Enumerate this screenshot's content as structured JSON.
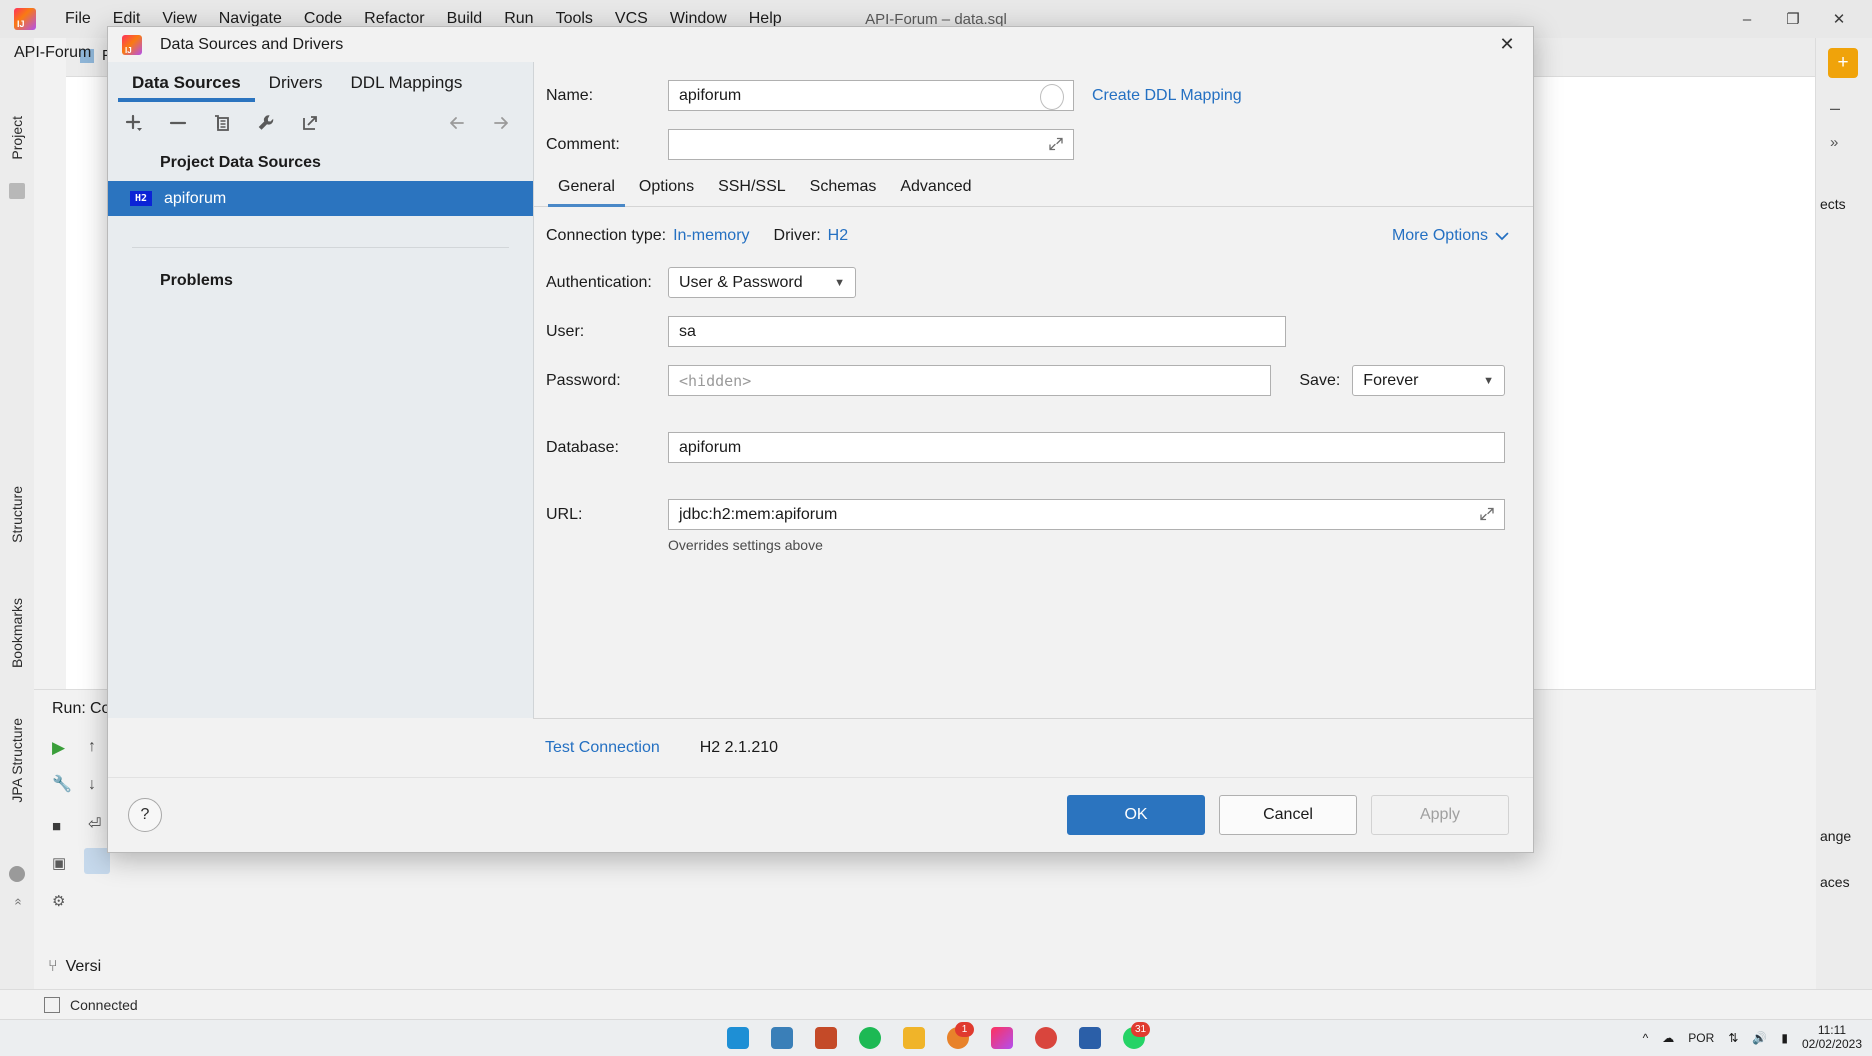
{
  "ide": {
    "window_title": "API-Forum – data.sql",
    "menu": [
      "File",
      "Edit",
      "View",
      "Navigate",
      "Code",
      "Refactor",
      "Build",
      "Run",
      "Tools",
      "VCS",
      "Window",
      "Help"
    ],
    "project_label": "API-Forum",
    "project_tab": "Proje",
    "left_rails": [
      "Project",
      "Structure",
      "Bookmarks",
      "JPA Structure"
    ],
    "run_label": "Run:",
    "run_tab": "Co",
    "version_control": "Versi",
    "status": "Connected",
    "right_edge_labels": [
      "ects",
      "ange",
      "aces"
    ],
    "window_buttons": [
      "–",
      "❐",
      "✕"
    ]
  },
  "taskbar": {
    "clock_time": "11:11",
    "clock_date": "02/02/2023",
    "language": "POR",
    "badges": [
      "1",
      "31"
    ]
  },
  "dialog": {
    "title": "Data Sources and Drivers",
    "close_label": "✕",
    "top_tabs": [
      {
        "label": "Data Sources",
        "active": true
      },
      {
        "label": "Drivers",
        "active": false
      },
      {
        "label": "DDL Mappings",
        "active": false
      }
    ],
    "toolbar": [
      {
        "name": "add-icon",
        "glyph": "+"
      },
      {
        "name": "remove-icon",
        "glyph": "–"
      },
      {
        "name": "copy-icon",
        "glyph": "❐"
      },
      {
        "name": "wrench-icon",
        "glyph": "🔧"
      },
      {
        "name": "open-external-icon",
        "glyph": "↗"
      },
      {
        "name": "back-arrow-icon",
        "glyph": "←"
      },
      {
        "name": "forward-arrow-icon",
        "glyph": "→"
      }
    ],
    "group_title": "Project Data Sources",
    "data_sources": [
      {
        "badge": "H2",
        "name": "apiforum",
        "selected": true
      }
    ],
    "problems_title": "Problems",
    "name_label": "Name:",
    "name_value": "apiforum",
    "comment_label": "Comment:",
    "comment_value": "",
    "create_ddl_mapping": "Create DDL Mapping",
    "inner_tabs": [
      {
        "label": "General",
        "active": true
      },
      {
        "label": "Options",
        "active": false
      },
      {
        "label": "SSH/SSL",
        "active": false
      },
      {
        "label": "Schemas",
        "active": false
      },
      {
        "label": "Advanced",
        "active": false
      }
    ],
    "connection_type_label": "Connection type:",
    "connection_type_value": "In-memory",
    "driver_label": "Driver:",
    "driver_value": "H2",
    "more_options": "More Options",
    "authentication_label": "Authentication:",
    "authentication_value": "User & Password",
    "user_label": "User:",
    "user_value": "sa",
    "password_label": "Password:",
    "password_placeholder": "<hidden>",
    "save_label": "Save:",
    "save_value": "Forever",
    "database_label": "Database:",
    "database_value": "apiforum",
    "url_label": "URL:",
    "url_value": "jdbc:h2:mem:apiforum",
    "url_hint": "Overrides settings above",
    "test_connection": "Test Connection",
    "driver_version": "H2 2.1.210",
    "help_glyph": "?",
    "ok_label": "OK",
    "cancel_label": "Cancel",
    "apply_label": "Apply"
  },
  "colors": {
    "accent_blue": "#2b74bf",
    "link_blue": "#2470c2",
    "selection_blue": "#2b74bf",
    "h2_badge_blue": "#0b23d6",
    "dialog_bg": "#f2f2f2",
    "left_pane_bg": "#e8ecef"
  }
}
